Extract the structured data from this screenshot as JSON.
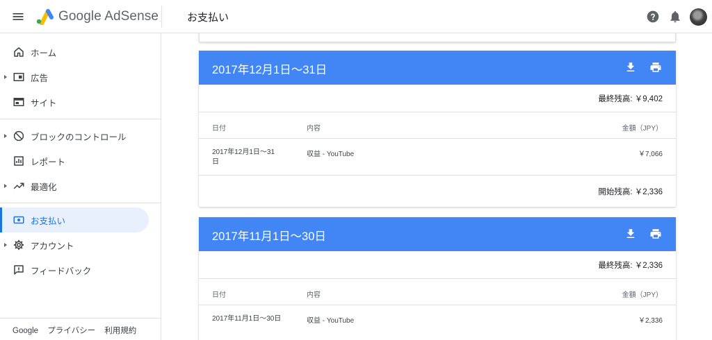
{
  "topbar": {
    "brand": "Google AdSense",
    "page_title": "お支払い",
    "colors": {
      "accent": "#4285f4",
      "active": "#1a73e8"
    }
  },
  "sidebar": {
    "items": [
      {
        "label": "ホーム",
        "icon": "home-icon",
        "expandable": false
      },
      {
        "label": "広告",
        "icon": "ads-icon",
        "expandable": true
      },
      {
        "label": "サイト",
        "icon": "sites-icon",
        "expandable": false
      },
      {
        "label": "ブロックのコントロール",
        "icon": "block-icon",
        "expandable": true
      },
      {
        "label": "レポート",
        "icon": "report-icon",
        "expandable": false
      },
      {
        "label": "最適化",
        "icon": "trending-up-icon",
        "expandable": true
      },
      {
        "label": "お支払い",
        "icon": "payments-icon",
        "expandable": false,
        "active": true
      },
      {
        "label": "アカウント",
        "icon": "gear-icon",
        "expandable": true
      },
      {
        "label": "フィードバック",
        "icon": "feedback-icon",
        "expandable": false
      }
    ],
    "footer": {
      "google": "Google",
      "privacy": "プライバシー",
      "terms": "利用規約"
    }
  },
  "cards": [
    {
      "title": "2017年12月1日～31日",
      "ending_balance": "最終残高: ￥9,402",
      "columns": {
        "date": "日付",
        "description": "内容",
        "amount": "金額（JPY）"
      },
      "rows": [
        {
          "date": "2017年12月1日～31日",
          "description": "収益 - YouTube",
          "amount": "￥7,066"
        }
      ],
      "starting_balance": "開始残高: ￥2,336"
    },
    {
      "title": "2017年11月1日～30日",
      "ending_balance": "最終残高: ￥2,336",
      "columns": {
        "date": "日付",
        "description": "内容",
        "amount": "金額（JPY）"
      },
      "rows": [
        {
          "date": "2017年11月1日～30日",
          "description": "収益 - YouTube",
          "amount": "￥2,336"
        }
      ]
    }
  ]
}
